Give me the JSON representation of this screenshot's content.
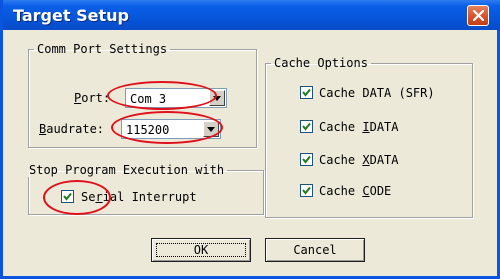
{
  "window": {
    "title": "Target Setup"
  },
  "comm_port": {
    "legend": "Comm Port Settings",
    "port_label_accel": "P",
    "port_label_rest": "ort:",
    "port_value": "Com 3",
    "baud_label_accel": "B",
    "baud_label_rest": "audrate:",
    "baud_value": "115200"
  },
  "stop_exec": {
    "legend": "Stop Program Execution with",
    "serial_label_pre": "Se",
    "serial_label_accel": "r",
    "serial_label_post": "ial Interrupt",
    "serial_checked": true
  },
  "cache": {
    "legend": "Cache Options",
    "items": [
      {
        "pre": "Cache DATA (SFR)",
        "accel": "",
        "post": "",
        "checked": true
      },
      {
        "pre": "Cache ",
        "accel": "I",
        "post": "DATA",
        "checked": true
      },
      {
        "pre": "Cache ",
        "accel": "X",
        "post": "DATA",
        "checked": true
      },
      {
        "pre": "Cache ",
        "accel": "C",
        "post": "ODE",
        "checked": true
      }
    ]
  },
  "buttons": {
    "ok": "OK",
    "cancel": "Cancel"
  },
  "colors": {
    "titlebar": "#0553d6",
    "close": "#d8522c",
    "annotation": "#e0101a"
  }
}
